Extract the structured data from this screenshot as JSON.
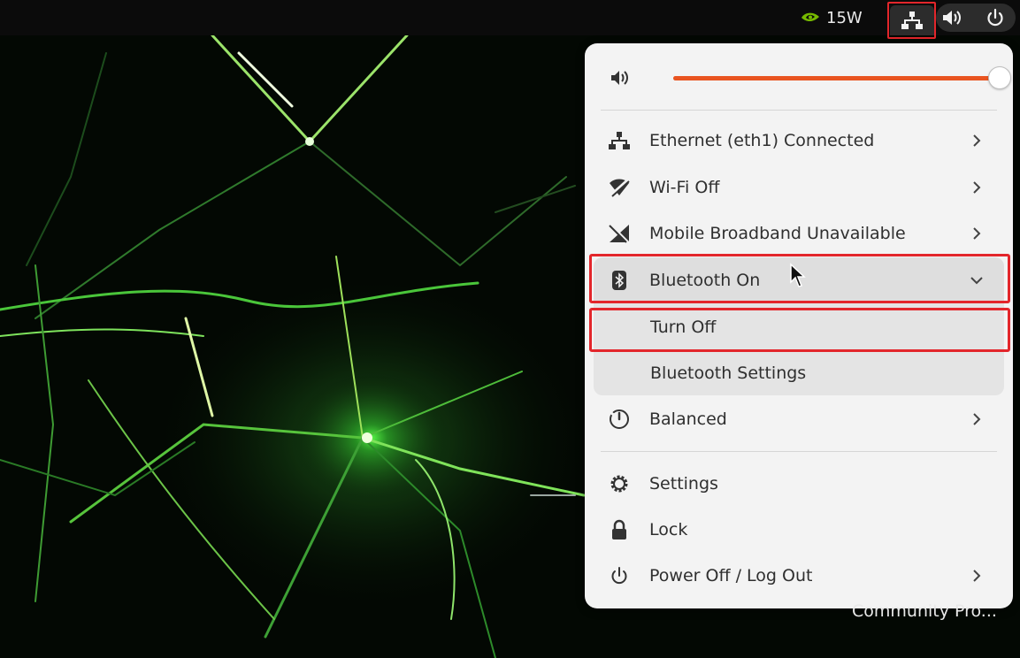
{
  "topbar": {
    "gpu_power": "15W",
    "icons": [
      "nvidia-icon",
      "network-wired-icon",
      "volume-icon",
      "power-icon"
    ]
  },
  "menu": {
    "volume": {
      "level": 0.99
    },
    "items": [
      {
        "label": "Ethernet (eth1) Connected",
        "icon": "network-wired-icon",
        "has_arrow": true
      },
      {
        "label": "Wi-Fi Off",
        "icon": "wifi-off-icon",
        "has_arrow": true
      },
      {
        "label": "Mobile Broadband Unavailable",
        "icon": "mobile-broadband-off-icon",
        "has_arrow": true
      },
      {
        "label": "Bluetooth On",
        "icon": "bluetooth-icon",
        "expanded": true
      },
      {
        "label": "Balanced",
        "icon": "power-profile-icon",
        "has_arrow": true
      }
    ],
    "bluetooth_submenu": [
      "Turn Off",
      "Bluetooth Settings"
    ],
    "system_items": [
      {
        "label": "Settings",
        "icon": "gear-icon"
      },
      {
        "label": "Lock",
        "icon": "lock-icon"
      },
      {
        "label": "Power Off / Log Out",
        "icon": "power-icon",
        "has_arrow": true
      }
    ]
  },
  "desktop": {
    "watermark": "Community Pro..."
  },
  "colors": {
    "accent": "#e95420",
    "highlight": "#e3262b",
    "menu_bg": "#f3f3f3",
    "topbar_bg": "#0b0b0b"
  }
}
